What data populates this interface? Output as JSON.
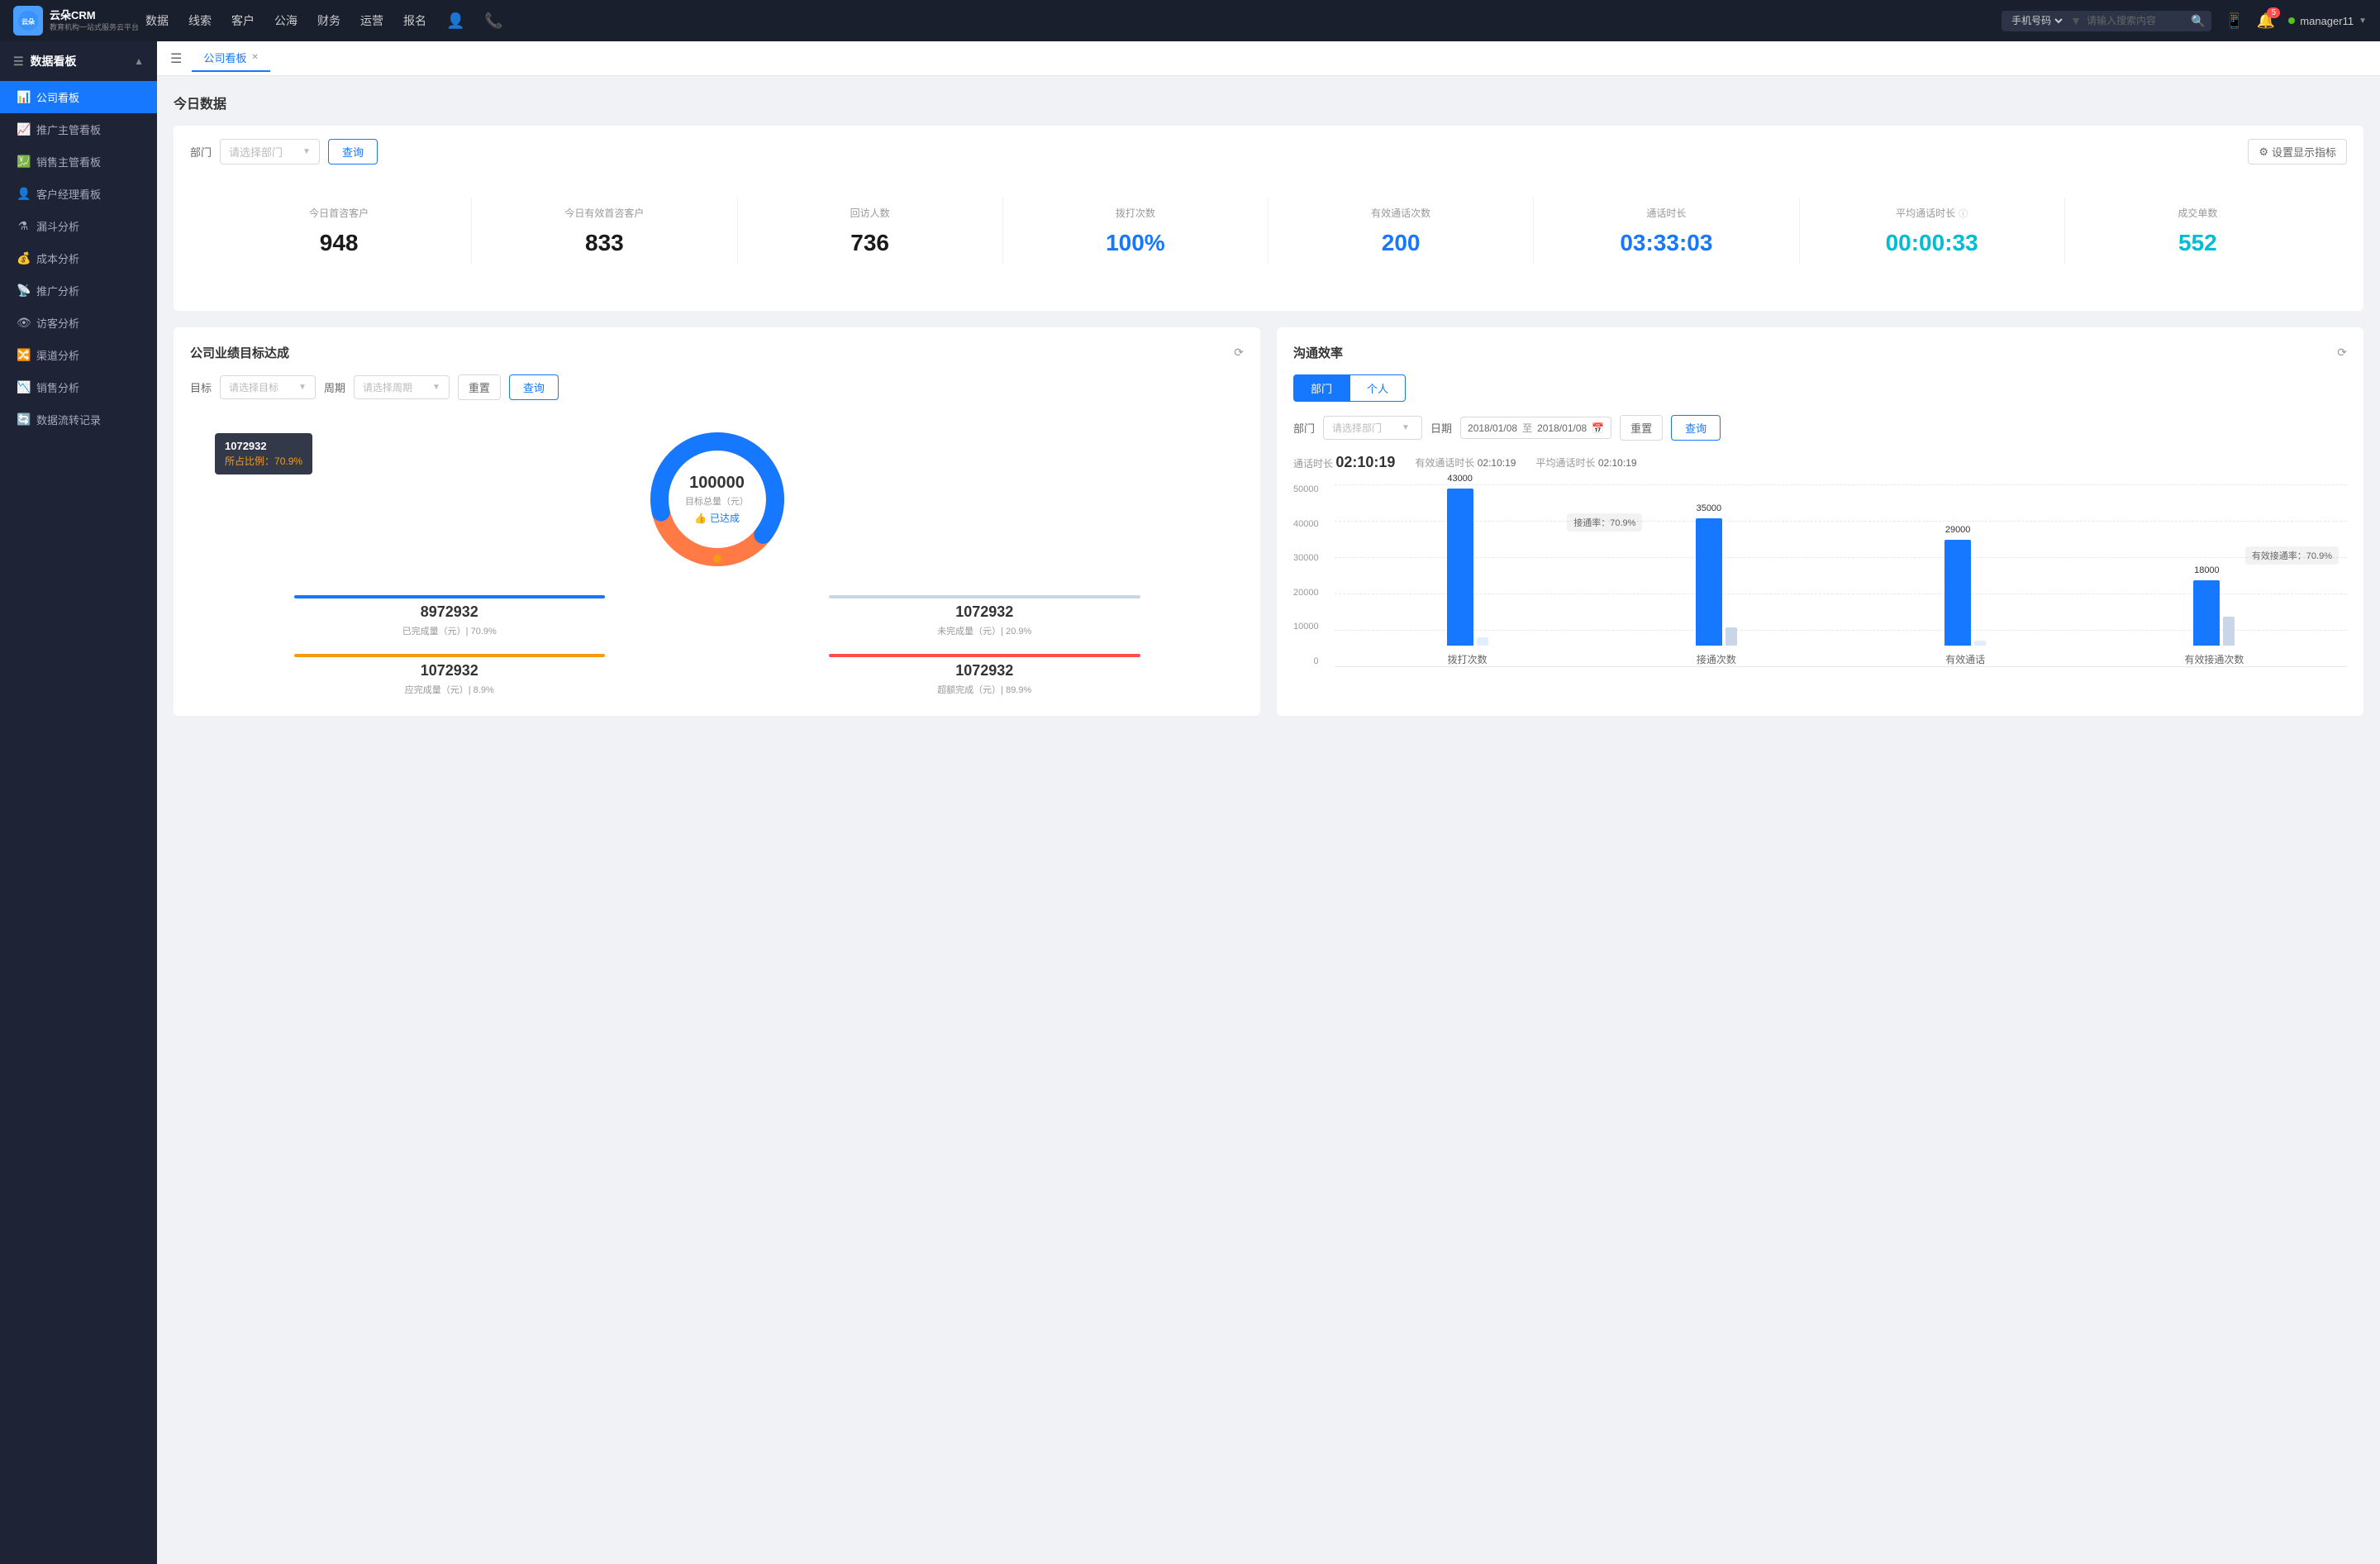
{
  "app": {
    "logo_line1": "云朵CRM",
    "logo_line2": "教育机构一站式服务云平台"
  },
  "topnav": {
    "items": [
      "数据",
      "线索",
      "客户",
      "公海",
      "财务",
      "运营",
      "报名"
    ],
    "search_placeholder": "请输入搜索内容",
    "search_option": "手机号码",
    "notification_count": "5",
    "username": "manager11"
  },
  "sidebar": {
    "header": "数据看板",
    "items": [
      {
        "label": "公司看板",
        "icon": "📊",
        "active": true
      },
      {
        "label": "推广主管看板",
        "icon": "📈",
        "active": false
      },
      {
        "label": "销售主管看板",
        "icon": "💹",
        "active": false
      },
      {
        "label": "客户经理看板",
        "icon": "👤",
        "active": false
      },
      {
        "label": "漏斗分析",
        "icon": "⚗",
        "active": false
      },
      {
        "label": "成本分析",
        "icon": "💰",
        "active": false
      },
      {
        "label": "推广分析",
        "icon": "📡",
        "active": false
      },
      {
        "label": "访客分析",
        "icon": "👁",
        "active": false
      },
      {
        "label": "渠道分析",
        "icon": "🔀",
        "active": false
      },
      {
        "label": "销售分析",
        "icon": "📉",
        "active": false
      },
      {
        "label": "数据流转记录",
        "icon": "🔄",
        "active": false
      }
    ]
  },
  "tabs": [
    {
      "label": "公司看板",
      "active": true,
      "closable": true
    }
  ],
  "today_section": {
    "title": "今日数据",
    "filter_label": "部门",
    "select_placeholder": "请选择部门",
    "query_btn": "查询",
    "settings_btn": "设置显示指标"
  },
  "stats": [
    {
      "label": "今日首咨客户",
      "value": "948",
      "color": "dark"
    },
    {
      "label": "今日有效首咨客户",
      "value": "833",
      "color": "dark"
    },
    {
      "label": "回访人数",
      "value": "736",
      "color": "dark"
    },
    {
      "label": "拨打次数",
      "value": "100%",
      "color": "blue"
    },
    {
      "label": "有效通话次数",
      "value": "200",
      "color": "blue"
    },
    {
      "label": "通话时长",
      "value": "03:33:03",
      "color": "blue"
    },
    {
      "label": "平均通话时长",
      "value": "00:00:33",
      "color": "cyan"
    },
    {
      "label": "成交单数",
      "value": "552",
      "color": "cyan"
    }
  ],
  "goal_panel": {
    "title": "公司业绩目标达成",
    "goal_label": "目标",
    "goal_placeholder": "请选择目标",
    "period_label": "周期",
    "period_placeholder": "请选择周期",
    "reset_btn": "重置",
    "query_btn": "查询",
    "donut": {
      "total": "100000",
      "total_label": "目标总量（元）",
      "achieved_label": "已达成",
      "tooltip_value": "1072932",
      "tooltip_pct_label": "所占比例：",
      "tooltip_pct": "70.9%"
    },
    "summary": [
      {
        "value": "8972932",
        "label": "已完成量（元）| 70.9%",
        "color": "#1677ff"
      },
      {
        "value": "1072932",
        "label": "未完成量（元）| 20.9%",
        "color": "#c8d6e8"
      },
      {
        "value": "1072932",
        "label": "应完成量（元）| 8.9%",
        "color": "#f39c12"
      },
      {
        "value": "1072932",
        "label": "超额完成（元）| 89.9%",
        "color": "#ff4d4f"
      }
    ]
  },
  "comm_panel": {
    "title": "沟通效率",
    "tabs": [
      "部门",
      "个人"
    ],
    "active_tab": 0,
    "dept_label": "部门",
    "dept_placeholder": "请选择部门",
    "date_label": "日期",
    "date_from": "2018/01/08",
    "date_to": "2018/01/08",
    "reset_btn": "重置",
    "query_btn": "查询",
    "stats": {
      "call_duration_label": "通话时长",
      "call_duration": "02:10:19",
      "effective_label": "有效通话时长",
      "effective_value": "02:10:19",
      "avg_label": "平均通话时长",
      "avg_value": "02:10:19"
    },
    "chart": {
      "y_labels": [
        "50000",
        "40000",
        "30000",
        "20000",
        "10000",
        "0"
      ],
      "groups": [
        {
          "x_label": "拨打次数",
          "bars": [
            {
              "value": 43000,
              "label": "43000",
              "pct": 86,
              "color": "blue"
            },
            {
              "value": 0,
              "label": "",
              "pct": 0,
              "color": "light-blue"
            }
          ]
        },
        {
          "x_label": "接通次数",
          "annotation": "接通率：70.9%",
          "bars": [
            {
              "value": 35000,
              "label": "35000",
              "pct": 70,
              "color": "blue"
            },
            {
              "value": 0,
              "label": "",
              "pct": 5,
              "color": "light-blue"
            }
          ]
        },
        {
          "x_label": "有效通话",
          "bars": [
            {
              "value": 29000,
              "label": "29000",
              "pct": 58,
              "color": "blue"
            },
            {
              "value": 0,
              "label": "",
              "pct": 0,
              "color": "light-blue"
            }
          ]
        },
        {
          "x_label": "有效接通次数",
          "annotation": "有效接通率：70.9%",
          "bars": [
            {
              "value": 18000,
              "label": "18000",
              "pct": 36,
              "color": "blue"
            },
            {
              "value": 0,
              "label": "",
              "pct": 8,
              "color": "light-blue"
            }
          ]
        }
      ]
    }
  }
}
